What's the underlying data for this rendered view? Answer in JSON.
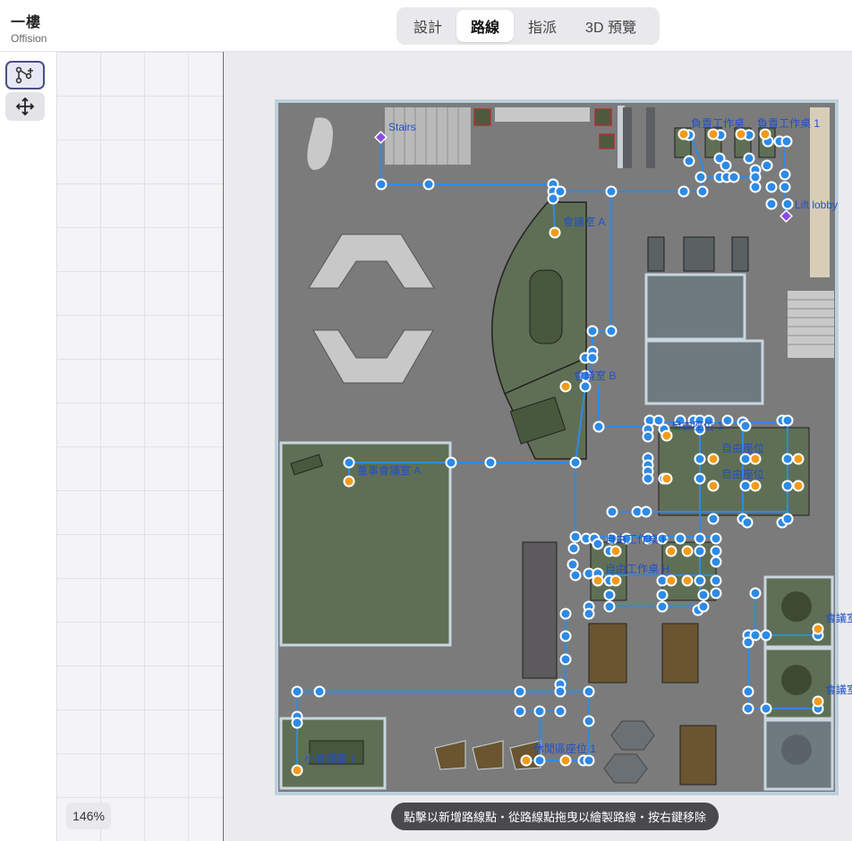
{
  "app": {
    "title": "一樓",
    "subtitle": "Offision"
  },
  "tabs": [
    {
      "label": "設計",
      "active": false
    },
    {
      "label": "路線",
      "active": true
    },
    {
      "label": "指派",
      "active": false
    },
    {
      "label": "3D 預覽",
      "active": false
    }
  ],
  "toolbar": {
    "tools": [
      {
        "name": "route-tool",
        "icon": "route-add-icon",
        "active": true
      },
      {
        "name": "move-tool",
        "icon": "move-arrows-icon",
        "active": false
      }
    ]
  },
  "zoom": {
    "label": "146%"
  },
  "hint": {
    "text": "點擊以新增路線點・從路線點拖曳以繪製路線・按右鍵移除"
  },
  "floorplan": {
    "labels": {
      "stairs": "Stairs",
      "lift_lobby": "Lift lobby",
      "meeting_a": "會議室 A",
      "meeting_b": "會議室 B",
      "board_room_a": "董事會議室 A",
      "hot_desk_1": "自由座位 1",
      "hot_desk": "自由座位",
      "hot_desk_2": "自由座位",
      "manager_desk_1": "負責工作桌",
      "manager_desk_2": "負責工作桌 1",
      "meeting_e": "會議室",
      "meeting_f": "會議室",
      "desk_f": "自由工作桌 F",
      "desk_h": "自由工作桌 H",
      "small_meeting_1": "小會議室 1",
      "lounge_seat_1": "休閒區座位 1"
    },
    "colors": {
      "floor": "#7b7b7c",
      "room_green": "#5f6f55",
      "glass_room": "#6f7a80",
      "route_line": "#2d8ae6",
      "route_point": "#2d8ae6",
      "seat_point": "#f39a1c",
      "poi_marker": "#8a4ce6",
      "label_text": "#1f4fc9"
    }
  }
}
